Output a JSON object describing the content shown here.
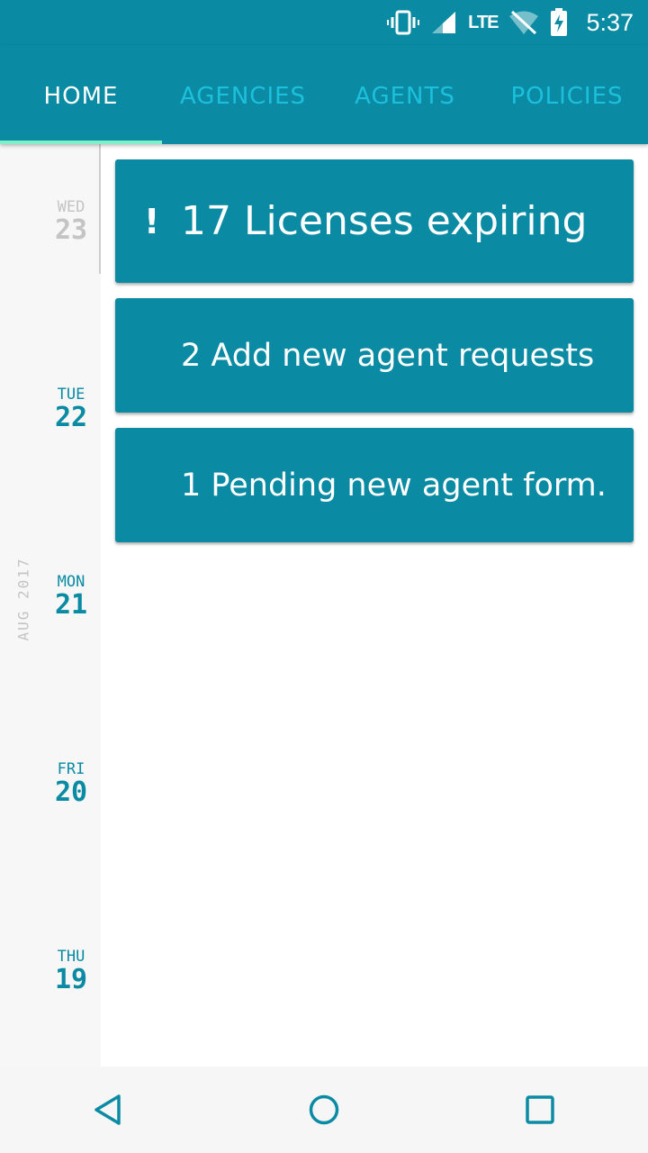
{
  "status_bar": {
    "network": "LTE",
    "time": "5:37",
    "icons": [
      "vibrate-icon",
      "signal-icon",
      "wifi-off-icon",
      "battery-charging-icon"
    ]
  },
  "tabs": [
    {
      "label": "HOME",
      "active": true
    },
    {
      "label": "AGENCIES",
      "active": false
    },
    {
      "label": "AGENTS",
      "active": false
    },
    {
      "label": "POLICIES",
      "active": false
    }
  ],
  "timeline": {
    "month": "AUG 2017",
    "days": [
      {
        "dow": "WED",
        "dom": "23",
        "past": true
      },
      {
        "dow": "TUE",
        "dom": "22",
        "past": false
      },
      {
        "dow": "MON",
        "dom": "21",
        "past": false
      },
      {
        "dow": "FRI",
        "dom": "20",
        "past": false
      },
      {
        "dow": "THU",
        "dom": "19",
        "past": false
      }
    ]
  },
  "cards": [
    {
      "alert": "!",
      "text": "17 Licenses expiring"
    },
    {
      "alert": "",
      "text": "2 Add new agent requests"
    },
    {
      "alert": "",
      "text": "1 Pending new agent form."
    }
  ],
  "colors": {
    "primary": "#0a8ba3",
    "tab_inactive": "#1cc0dd",
    "indicator": "#7ff0c8",
    "muted": "#c4c4c4"
  }
}
